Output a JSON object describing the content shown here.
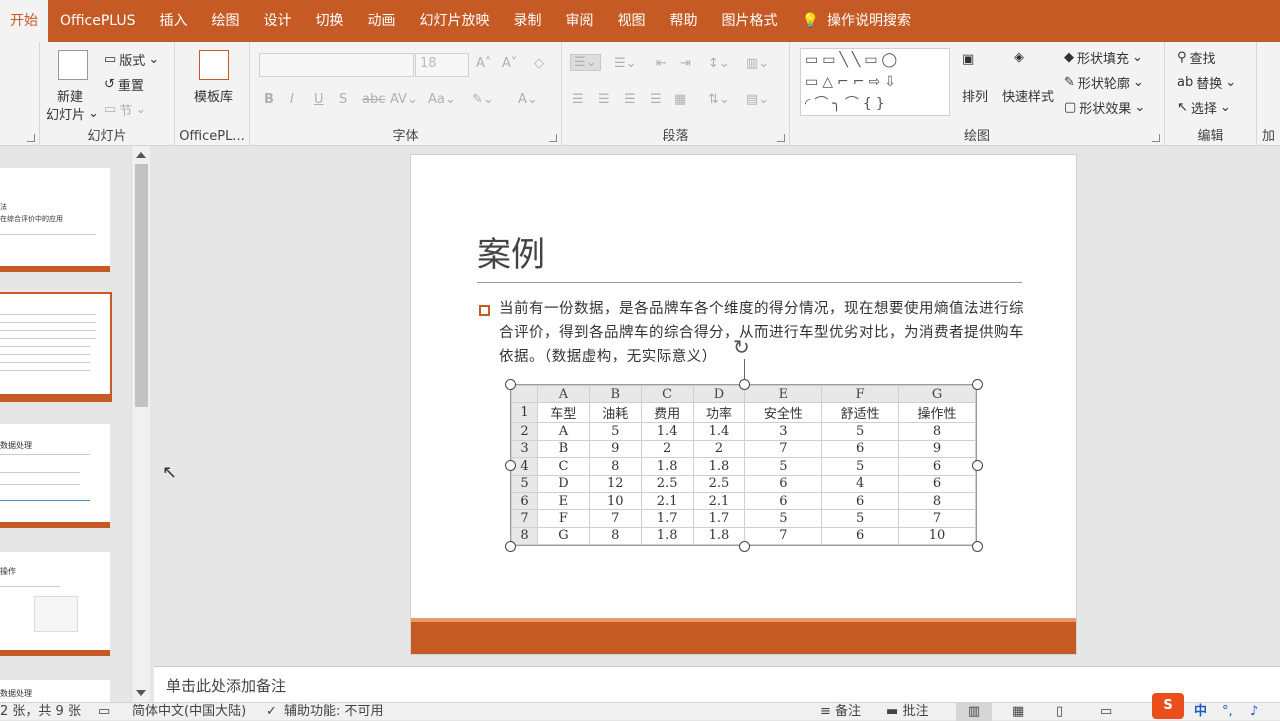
{
  "tabs": [
    "开始",
    "OfficePLUS",
    "插入",
    "绘图",
    "设计",
    "切换",
    "动画",
    "幻灯片放映",
    "录制",
    "审阅",
    "视图",
    "帮助",
    "图片格式"
  ],
  "tell_me": "操作说明搜索",
  "ribbon": {
    "slides_group": {
      "label": "幻灯片",
      "new_slide": "新建",
      "new_slide2": "幻灯片",
      "layout": "版式",
      "reset": "重置",
      "section": "节"
    },
    "officeplus_group": {
      "label": "OfficePL...",
      "template": "模板库"
    },
    "font_group": {
      "label": "字体",
      "font_name": "",
      "font_size": "18"
    },
    "paragraph_group": {
      "label": "段落"
    },
    "drawing_group": {
      "label": "绘图",
      "arrange": "排列",
      "quick_styles": "快速样式",
      "shape_fill": "形状填充",
      "shape_outline": "形状轮廓",
      "shape_effects": "形状效果"
    },
    "editing_group": {
      "label": "编辑",
      "find": "查找",
      "replace": "替换",
      "select": "选择"
    },
    "extra_label": "加"
  },
  "thumbnails": {
    "t1": {
      "line1": "法",
      "line2": "在综合评价中的应用"
    },
    "t3": {
      "title": "数据处理"
    },
    "t4": {
      "title": "操作"
    },
    "t5": {
      "title": "数据处理"
    }
  },
  "slide": {
    "title": "案例",
    "body": "当前有一份数据，是各品牌车各个维度的得分情况，现在想要使用熵值法进行综合评价，得到各品牌车的综合得分，从而进行车型优劣对比，为消费者提供购车依据。（数据虚构，无实际意义）",
    "table": {
      "col_letters": [
        "A",
        "B",
        "C",
        "D",
        "E",
        "F",
        "G"
      ],
      "rows": [
        [
          "1",
          "车型",
          "油耗",
          "费用",
          "功率",
          "安全性",
          "舒适性",
          "操作性"
        ],
        [
          "2",
          "A",
          "5",
          "1.4",
          "1.4",
          "3",
          "5",
          "8"
        ],
        [
          "3",
          "B",
          "9",
          "2",
          "2",
          "7",
          "6",
          "9"
        ],
        [
          "4",
          "C",
          "8",
          "1.8",
          "1.8",
          "5",
          "5",
          "6"
        ],
        [
          "5",
          "D",
          "12",
          "2.5",
          "2.5",
          "6",
          "4",
          "6"
        ],
        [
          "6",
          "E",
          "10",
          "2.1",
          "2.1",
          "6",
          "6",
          "8"
        ],
        [
          "7",
          "F",
          "7",
          "1.7",
          "1.7",
          "5",
          "5",
          "7"
        ],
        [
          "8",
          "G",
          "8",
          "1.8",
          "1.8",
          "7",
          "6",
          "10"
        ]
      ]
    }
  },
  "notes_placeholder": "单击此处添加备注",
  "status": {
    "slide_count": "2 张，共 9 张",
    "language": "简体中文(中国大陆)",
    "accessibility": "辅助功能: 不可用",
    "notes": "备注",
    "comments": "批注",
    "ime": "中"
  }
}
